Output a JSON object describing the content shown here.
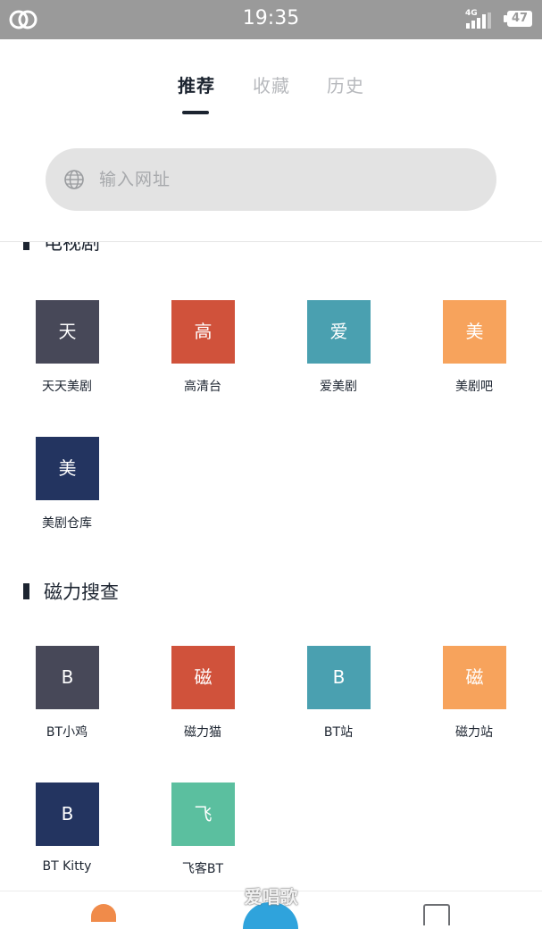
{
  "status_bar": {
    "time": "19:35",
    "network": "4G",
    "battery": "47"
  },
  "tabs": [
    {
      "label": "推荐",
      "active": true
    },
    {
      "label": "收藏",
      "active": false
    },
    {
      "label": "历史",
      "active": false
    }
  ],
  "search": {
    "placeholder": "输入网址"
  },
  "sections": [
    {
      "title": "电视剧",
      "items": [
        {
          "glyph": "天",
          "label": "天天美剧",
          "color": "#474858"
        },
        {
          "glyph": "高",
          "label": "高清台",
          "color": "#d0523b"
        },
        {
          "glyph": "爱",
          "label": "爱美剧",
          "color": "#4aa0b0"
        },
        {
          "glyph": "美",
          "label": "美剧吧",
          "color": "#f7a35c"
        },
        {
          "glyph": "美",
          "label": "美剧仓库",
          "color": "#233460"
        }
      ]
    },
    {
      "title": "磁力搜查",
      "items": [
        {
          "glyph": "B",
          "label": "BT小鸡",
          "color": "#474858"
        },
        {
          "glyph": "磁",
          "label": "磁力猫",
          "color": "#d0523b"
        },
        {
          "glyph": "B",
          "label": "BT站",
          "color": "#4aa0b0"
        },
        {
          "glyph": "磁",
          "label": "磁力站",
          "color": "#f7a35c"
        },
        {
          "glyph": "B",
          "label": "BT Kitty",
          "color": "#233460"
        },
        {
          "glyph": "飞",
          "label": "飞客BT",
          "color": "#5bbf9f"
        }
      ]
    }
  ],
  "watermark": "爱唱歌"
}
